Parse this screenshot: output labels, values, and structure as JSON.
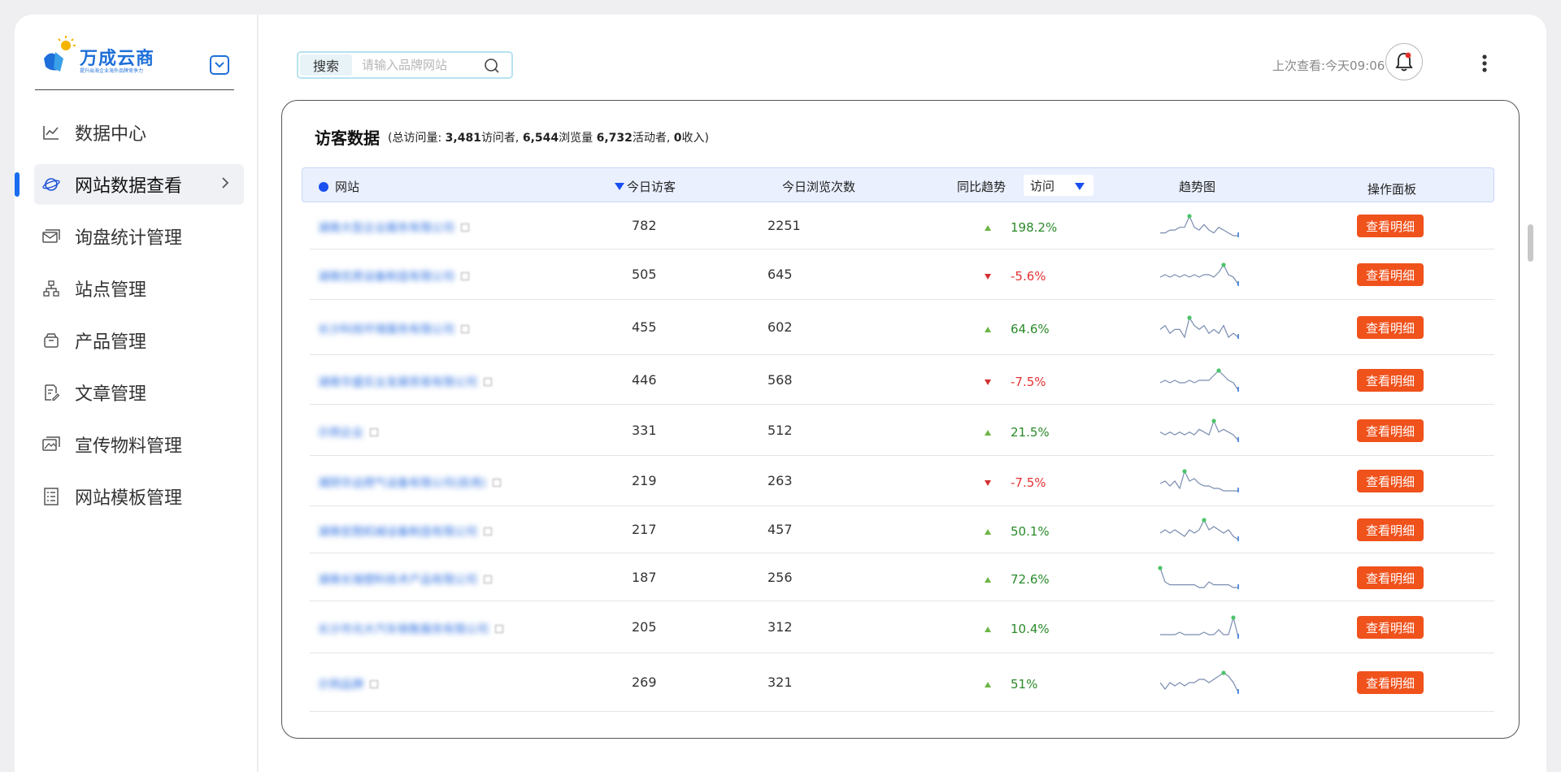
{
  "brand": {
    "name": "万成云商",
    "slogan": "提升出海企业海外品牌竞争力"
  },
  "sidebar": {
    "items": [
      {
        "label": "数据中心",
        "icon": "line-chart-icon",
        "active": false
      },
      {
        "label": "网站数据查看",
        "icon": "planet-icon",
        "active": true
      },
      {
        "label": "询盘统计管理",
        "icon": "mail-icon",
        "active": false
      },
      {
        "label": "站点管理",
        "icon": "sitemap-icon",
        "active": false
      },
      {
        "label": "产品管理",
        "icon": "box-icon",
        "active": false
      },
      {
        "label": "文章管理",
        "icon": "article-icon",
        "active": false
      },
      {
        "label": "宣传物料管理",
        "icon": "image-icon",
        "active": false
      },
      {
        "label": "网站模板管理",
        "icon": "template-icon",
        "active": false
      }
    ]
  },
  "header": {
    "search_button": "搜索",
    "search_placeholder": "请输入品牌网站",
    "last_view": "上次查看:今天09:06"
  },
  "panel": {
    "title": "访客数据",
    "subtitle_prefix": "(总访问量: ",
    "visitors": "3,481",
    "visitors_label": "访问者, ",
    "pageviews": "6,544",
    "pageviews_label": "浏览量 ",
    "active": "6,732",
    "active_label": "活动者, ",
    "revenue": "0",
    "revenue_label": "收入)"
  },
  "table": {
    "columns": {
      "site": "网站",
      "today_visitors": "今日访客",
      "today_views": "今日浏览次数",
      "yoy_trend": "同比趋势",
      "trend_metric": "访问",
      "sparkline": "趋势图",
      "actions": "操作面板"
    },
    "action_label": "查看明细",
    "rows": [
      {
        "site": "湖南大型企业服务有限公司",
        "visitors": "782",
        "views": "2251",
        "trend": "198.2%",
        "dir": "up",
        "spark": [
          3,
          3,
          4,
          4,
          5,
          5,
          9,
          5,
          4,
          6,
          4,
          3,
          5,
          4,
          3,
          2,
          2
        ]
      },
      {
        "site": "湖南优质设备制造有限公司",
        "visitors": "505",
        "views": "645",
        "trend": "-5.6%",
        "dir": "down",
        "spark": [
          4,
          5,
          4,
          5,
          4,
          5,
          4,
          5,
          4,
          5,
          5,
          4,
          6,
          9,
          5,
          4,
          1
        ]
      },
      {
        "site": "长沙科技环境服务有限公司",
        "visitors": "455",
        "views": "602",
        "trend": "64.6%",
        "dir": "up",
        "spark": [
          5,
          6,
          4,
          5,
          5,
          3,
          8,
          6,
          5,
          6,
          4,
          5,
          4,
          6,
          3,
          4,
          3
        ]
      },
      {
        "site": "湖南华盛实业发展贸易有限公司",
        "visitors": "446",
        "views": "568",
        "trend": "-7.5%",
        "dir": "down",
        "spark": [
          5,
          6,
          5,
          6,
          5,
          5,
          6,
          5,
          6,
          6,
          6,
          8,
          10,
          8,
          6,
          5,
          2
        ]
      },
      {
        "site": "示例企业",
        "visitors": "331",
        "views": "512",
        "trend": "21.5%",
        "dir": "up",
        "spark": [
          5,
          4,
          5,
          4,
          5,
          4,
          5,
          4,
          6,
          5,
          4,
          9,
          5,
          6,
          5,
          4,
          2
        ]
      },
      {
        "site": "湘阴华运燃气设备有限公司(民用)",
        "visitors": "219",
        "views": "263",
        "trend": "-7.5%",
        "dir": "down",
        "spark": [
          5,
          6,
          4,
          6,
          3,
          10,
          6,
          7,
          5,
          4,
          4,
          3,
          3,
          2,
          2,
          2,
          2
        ]
      },
      {
        "site": "湖南宏图机械设备制造有限公司",
        "visitors": "217",
        "views": "457",
        "trend": "50.1%",
        "dir": "up",
        "spark": [
          5,
          6,
          5,
          6,
          5,
          4,
          6,
          5,
          6,
          9,
          6,
          7,
          6,
          5,
          6,
          4,
          3
        ]
      },
      {
        "site": "湖南长瑞塑料技术产品有限公司",
        "visitors": "187",
        "views": "256",
        "trend": "72.6%",
        "dir": "up",
        "spark": [
          10,
          5,
          4,
          4,
          4,
          4,
          4,
          4,
          3,
          3,
          5,
          4,
          4,
          4,
          4,
          3,
          3
        ]
      },
      {
        "site": "长沙市光大汽车销售服务有限公司",
        "visitors": "205",
        "views": "312",
        "trend": "10.4%",
        "dir": "up",
        "spark": [
          3,
          3,
          3,
          3,
          4,
          3,
          3,
          3,
          3,
          4,
          3,
          3,
          5,
          3,
          3,
          10,
          2
        ]
      },
      {
        "site": "示例品牌",
        "visitors": "269",
        "views": "321",
        "trend": "51%",
        "dir": "up",
        "spark": [
          5,
          3,
          5,
          4,
          5,
          4,
          5,
          5,
          6,
          6,
          5,
          6,
          7,
          8,
          7,
          5,
          2
        ]
      }
    ]
  },
  "colors": {
    "accent": "#1a50f0",
    "action": "#f0521c",
    "up": "#2a8a2a",
    "down": "#e23232"
  }
}
